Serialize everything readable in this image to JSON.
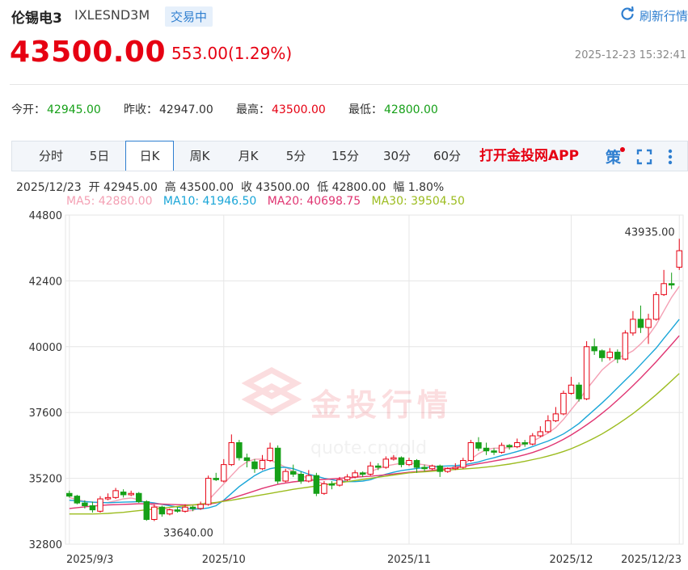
{
  "header": {
    "title": "伦锡电3",
    "code": "IXLESND3M",
    "status": "交易中",
    "refresh_label": "刷新行情"
  },
  "quote": {
    "price": "43500.00",
    "change": "553.00(1.29%)",
    "timestamp": "2025-12-23 15:32:41"
  },
  "stats": [
    {
      "label": "今开：",
      "value": "42945.00",
      "color": "#16a018"
    },
    {
      "label": "昨收：",
      "value": "42947.00",
      "color": "#333333"
    },
    {
      "label": "最高：",
      "value": "43500.00",
      "color": "#e60012"
    },
    {
      "label": "最低：",
      "value": "42800.00",
      "color": "#16a018"
    }
  ],
  "tabs": [
    "分时",
    "5日",
    "日K",
    "周K",
    "月K",
    "5分",
    "15分",
    "30分",
    "60分"
  ],
  "active_tab": "日K",
  "app_link": "打开金投网APP",
  "info_line": {
    "date": "2025/12/23",
    "open": "开 42945.00",
    "high": "高 43500.00",
    "close": "收 43500.00",
    "low": "低 42800.00",
    "amplitude": "幅 1.80%"
  },
  "ma_labels": [
    {
      "text": "MA5: 42880.00",
      "color": "#f4a0b4"
    },
    {
      "text": "MA10: 41946.50",
      "color": "#1aa6d8"
    },
    {
      "text": "MA20: 40698.75",
      "color": "#e03572"
    },
    {
      "text": "MA30: 39504.50",
      "color": "#9cbc1f"
    }
  ],
  "watermark": {
    "main": "金投行情",
    "sub": "quote.cngold"
  },
  "colors": {
    "up": "#e60012",
    "down": "#16a018",
    "accent": "#2f7fd0",
    "grid": "#e6e6e6"
  },
  "chart_data": {
    "type": "candlestick",
    "y_ticks": [
      "44800",
      "42400",
      "40000",
      "37600",
      "35200",
      "32800"
    ],
    "ylim": [
      32800,
      44800
    ],
    "x_labels": [
      {
        "label": "2025/9/3",
        "index": 0
      },
      {
        "label": "2025/10",
        "index": 20
      },
      {
        "label": "2025/11",
        "index": 44
      },
      {
        "label": "2025/12",
        "index": 65
      },
      {
        "label": "2025/12/23",
        "index": 79
      }
    ],
    "annotations": [
      {
        "text": "43935.00",
        "index": 78,
        "value": 43935
      },
      {
        "text": "33640.00",
        "index": 13,
        "value": 33640
      }
    ],
    "candles": [
      [
        34650,
        34550,
        34750,
        34500
      ],
      [
        34550,
        34300,
        34600,
        34250
      ],
      [
        34300,
        34200,
        34400,
        34100
      ],
      [
        34200,
        34050,
        34350,
        33950
      ],
      [
        34000,
        34450,
        34550,
        33950
      ],
      [
        34450,
        34500,
        34650,
        34400
      ],
      [
        34500,
        34750,
        34850,
        34450
      ],
      [
        34700,
        34600,
        34800,
        34500
      ],
      [
        34600,
        34650,
        34750,
        34550
      ],
      [
        34650,
        34350,
        34700,
        34300
      ],
      [
        34350,
        33700,
        34400,
        33650
      ],
      [
        33700,
        34150,
        34250,
        33640
      ],
      [
        34150,
        33900,
        34200,
        33800
      ],
      [
        33900,
        34050,
        34100,
        33850
      ],
      [
        34050,
        34000,
        34150,
        33950
      ],
      [
        34000,
        34150,
        34250,
        33950
      ],
      [
        34150,
        34100,
        34200,
        34000
      ],
      [
        34100,
        34250,
        34350,
        34050
      ],
      [
        34250,
        35200,
        35300,
        34200
      ],
      [
        35200,
        35150,
        35400,
        35100
      ],
      [
        35100,
        35700,
        35900,
        35050
      ],
      [
        35700,
        36500,
        36800,
        35650
      ],
      [
        36500,
        35950,
        36600,
        35850
      ],
      [
        35950,
        35850,
        36100,
        35600
      ],
      [
        35800,
        35550,
        35900,
        35400
      ],
      [
        35550,
        35850,
        36050,
        35500
      ],
      [
        35850,
        36300,
        36500,
        35800
      ],
      [
        36300,
        35100,
        36400,
        35000
      ],
      [
        35100,
        35450,
        35550,
        35050
      ],
      [
        35450,
        35350,
        35700,
        35250
      ],
      [
        35350,
        35100,
        35450,
        35000
      ],
      [
        35100,
        35300,
        35500,
        35050
      ],
      [
        35300,
        34650,
        35400,
        34550
      ],
      [
        34650,
        35000,
        35100,
        34600
      ],
      [
        35000,
        34950,
        35100,
        34800
      ],
      [
        34950,
        35150,
        35250,
        34900
      ],
      [
        35150,
        35250,
        35350,
        35100
      ],
      [
        35250,
        35400,
        35500,
        35200
      ],
      [
        35400,
        35350,
        35450,
        35250
      ],
      [
        35350,
        35650,
        35800,
        35300
      ],
      [
        35650,
        35600,
        35750,
        35500
      ],
      [
        35600,
        35900,
        36000,
        35550
      ],
      [
        35900,
        35950,
        36050,
        35850
      ],
      [
        35950,
        35700,
        36000,
        35600
      ],
      [
        35700,
        35850,
        35950,
        35650
      ],
      [
        35850,
        35600,
        35900,
        35400
      ],
      [
        35600,
        35550,
        35700,
        35450
      ],
      [
        35550,
        35650,
        35700,
        35500
      ],
      [
        35650,
        35450,
        35700,
        35250
      ],
      [
        35450,
        35550,
        35600,
        35400
      ],
      [
        35550,
        35600,
        35750,
        35500
      ],
      [
        35600,
        35850,
        35950,
        35550
      ],
      [
        35850,
        36500,
        36600,
        35800
      ],
      [
        36500,
        36300,
        36700,
        36200
      ],
      [
        36300,
        36200,
        36500,
        36050
      ],
      [
        36200,
        36150,
        36300,
        36050
      ],
      [
        36150,
        36400,
        36500,
        36100
      ],
      [
        36400,
        36350,
        36450,
        36250
      ],
      [
        36350,
        36500,
        36650,
        36300
      ],
      [
        36500,
        36450,
        36600,
        36350
      ],
      [
        36450,
        36750,
        36850,
        36400
      ],
      [
        36750,
        36900,
        37100,
        36700
      ],
      [
        36900,
        37300,
        37500,
        36850
      ],
      [
        37300,
        37550,
        37800,
        37250
      ],
      [
        37550,
        38300,
        38400,
        37500
      ],
      [
        38300,
        38600,
        38900,
        38250
      ],
      [
        38600,
        38100,
        38700,
        38000
      ],
      [
        38100,
        40000,
        40200,
        38050
      ],
      [
        40000,
        39850,
        40300,
        39700
      ],
      [
        39850,
        39600,
        39900,
        39450
      ],
      [
        39600,
        39800,
        39950,
        39500
      ],
      [
        39800,
        39550,
        39900,
        39400
      ],
      [
        39550,
        40500,
        40600,
        39500
      ],
      [
        40500,
        41000,
        41300,
        40400
      ],
      [
        41000,
        40700,
        41500,
        40500
      ],
      [
        40700,
        41000,
        41200,
        40100
      ],
      [
        41000,
        41900,
        42000,
        40950
      ],
      [
        41900,
        42300,
        42800,
        41850
      ],
      [
        42300,
        42250,
        42700,
        42100
      ],
      [
        42900,
        43500,
        43935,
        42800
      ]
    ],
    "series": [
      {
        "name": "MA5",
        "color": "#f4a0b4",
        "values": [
          34500,
          34420,
          34360,
          34330,
          34300,
          34320,
          34380,
          34450,
          34480,
          34420,
          34300,
          34200,
          34120,
          34050,
          34020,
          34000,
          34030,
          34150,
          34400,
          34700,
          35000,
          35300,
          35600,
          35800,
          35900,
          35900,
          35850,
          35750,
          35600,
          35450,
          35300,
          35200,
          35100,
          35000,
          34980,
          35050,
          35150,
          35250,
          35350,
          35450,
          35550,
          35650,
          35700,
          35750,
          35760,
          35730,
          35690,
          35650,
          35600,
          35570,
          35590,
          35700,
          35900,
          36100,
          36250,
          36300,
          36300,
          36320,
          36380,
          36450,
          36550,
          36700,
          36850,
          37050,
          37350,
          37700,
          38050,
          38450,
          38800,
          39150,
          39400,
          39600,
          39700,
          39850,
          40100,
          40400,
          40800,
          41300,
          41800,
          42200
        ]
      },
      {
        "name": "MA10",
        "color": "#1aa6d8",
        "values": [
          34400,
          34380,
          34350,
          34330,
          34320,
          34310,
          34320,
          34330,
          34340,
          34350,
          34340,
          34300,
          34250,
          34200,
          34150,
          34100,
          34080,
          34080,
          34120,
          34200,
          34400,
          34650,
          34900,
          35100,
          35300,
          35450,
          35550,
          35600,
          35600,
          35550,
          35450,
          35350,
          35280,
          35200,
          35150,
          35100,
          35080,
          35080,
          35100,
          35150,
          35250,
          35350,
          35420,
          35480,
          35520,
          35560,
          35590,
          35620,
          35640,
          35650,
          35660,
          35690,
          35740,
          35800,
          35880,
          35950,
          36030,
          36100,
          36180,
          36260,
          36360,
          36460,
          36560,
          36680,
          36820,
          37000,
          37200,
          37450,
          37700,
          37950,
          38220,
          38500,
          38780,
          39050,
          39350,
          39650,
          39950,
          40300,
          40650,
          41000
        ]
      },
      {
        "name": "MA20",
        "color": "#e03572",
        "values": [
          34100,
          34130,
          34160,
          34190,
          34210,
          34230,
          34240,
          34250,
          34260,
          34270,
          34270,
          34270,
          34260,
          34250,
          34240,
          34230,
          34230,
          34240,
          34260,
          34300,
          34380,
          34470,
          34560,
          34650,
          34740,
          34830,
          34910,
          34980,
          35030,
          35070,
          35100,
          35120,
          35140,
          35160,
          35180,
          35200,
          35220,
          35240,
          35260,
          35280,
          35300,
          35330,
          35360,
          35390,
          35420,
          35440,
          35460,
          35490,
          35520,
          35550,
          35590,
          35630,
          35680,
          35730,
          35780,
          35830,
          35880,
          35930,
          35990,
          36060,
          36140,
          36240,
          36350,
          36480,
          36620,
          36780,
          36960,
          37150,
          37350,
          37570,
          37800,
          38050,
          38310,
          38580,
          38860,
          39150,
          39450,
          39760,
          40080,
          40400
        ]
      },
      {
        "name": "MA30",
        "color": "#9cbc1f",
        "values": [
          33900,
          33900,
          33900,
          33900,
          33910,
          33920,
          33940,
          33960,
          33990,
          34020,
          34050,
          34080,
          34110,
          34140,
          34170,
          34200,
          34230,
          34260,
          34290,
          34320,
          34360,
          34400,
          34450,
          34500,
          34550,
          34600,
          34650,
          34700,
          34750,
          34800,
          34840,
          34880,
          34920,
          34960,
          35000,
          35040,
          35080,
          35120,
          35160,
          35200,
          35240,
          35280,
          35320,
          35360,
          35400,
          35420,
          35440,
          35460,
          35480,
          35500,
          35520,
          35540,
          35560,
          35580,
          35610,
          35640,
          35680,
          35720,
          35770,
          35820,
          35880,
          35940,
          36010,
          36090,
          36180,
          36280,
          36400,
          36530,
          36670,
          36820,
          36990,
          37170,
          37360,
          37560,
          37780,
          38010,
          38250,
          38500,
          38760,
          39020
        ]
      }
    ]
  }
}
